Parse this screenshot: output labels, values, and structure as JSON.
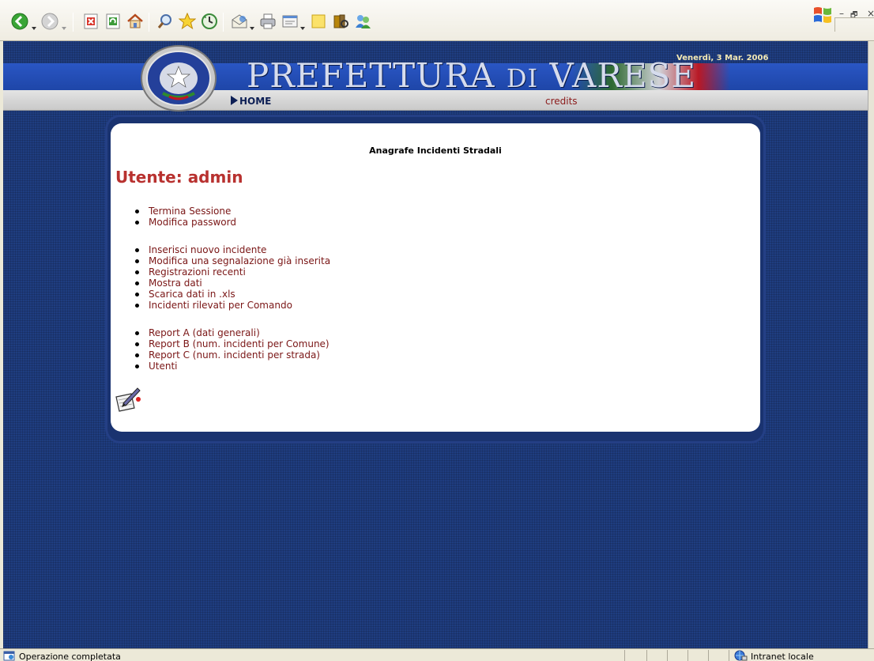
{
  "window": {
    "minimize_glyph": "–",
    "restore_glyph": "🗗",
    "close_glyph": "×"
  },
  "toolbar": {
    "buttons": [
      "back-icon",
      "forward-icon",
      "stop-icon",
      "refresh-icon",
      "home-icon",
      "search-icon",
      "favorites-icon",
      "history-icon",
      "mail-icon",
      "print-icon",
      "edit-icon",
      "notes-icon",
      "research-icon",
      "messenger-icon"
    ]
  },
  "header": {
    "date": "Venerdì, 3 Mar. 2006",
    "title_main": "PREFETTURA",
    "title_small": "DI",
    "title_end": "VARESE",
    "home_label": "HOME",
    "credits_label": "credits"
  },
  "content": {
    "title": "Anagrafe Incidenti Stradali",
    "user_line": "Utente: admin",
    "group1": [
      "Termina Sessione",
      "Modifica password"
    ],
    "group2": [
      "Inserisci nuovo incidente",
      "Modifica una segnalazione già inserita",
      "Registrazioni recenti",
      "Mostra dati",
      "Scarica dati in .xls",
      "Incidenti rilevati per Comando"
    ],
    "group3": [
      "Report A (dati generali)",
      "Report B (num. incidenti per Comune)",
      "Report C (num. incidenti per strada)",
      "Utenti"
    ]
  },
  "statusbar": {
    "text": "Operazione completata",
    "zone": "Intranet locale"
  },
  "colors": {
    "page_bg": "#1f3d80",
    "banner": "#2a56c4",
    "user_red": "#b8312f",
    "link": "#7a1616"
  }
}
